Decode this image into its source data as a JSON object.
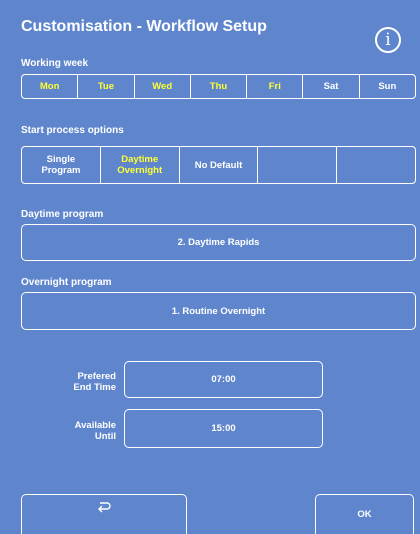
{
  "header": {
    "title": "Customisation - Workflow Setup",
    "info_glyph": "i"
  },
  "working_week": {
    "label": "Working week",
    "days": [
      {
        "label": "Mon",
        "selected": true
      },
      {
        "label": "Tue",
        "selected": true
      },
      {
        "label": "Wed",
        "selected": true
      },
      {
        "label": "Thu",
        "selected": true
      },
      {
        "label": "Fri",
        "selected": true
      },
      {
        "label": "Sat",
        "selected": false
      },
      {
        "label": "Sun",
        "selected": false
      }
    ]
  },
  "start_process": {
    "label": "Start process options",
    "options": [
      {
        "line1": "Single",
        "line2": "Program",
        "selected": false
      },
      {
        "line1": "Daytime",
        "line2": "Overnight",
        "selected": true
      },
      {
        "line1": "No Default",
        "line2": "",
        "selected": false
      },
      {
        "line1": "",
        "line2": "",
        "selected": false
      }
    ]
  },
  "daytime": {
    "label": "Daytime program",
    "value": "2. Daytime Rapids"
  },
  "overnight": {
    "label": "Overnight program",
    "value": "1. Routine Overnight"
  },
  "end_time": {
    "label_line1": "Prefered",
    "label_line2": "End Time",
    "value": "07:00"
  },
  "available": {
    "label_line1": "Available",
    "label_line2": "Until",
    "value": "15:00"
  },
  "footer": {
    "ok_label": "OK",
    "back_icon": "undo-arrow-icon"
  },
  "colors": {
    "background": "#5f86cc",
    "selected_text": "#ffff33",
    "text": "#ffffff"
  }
}
